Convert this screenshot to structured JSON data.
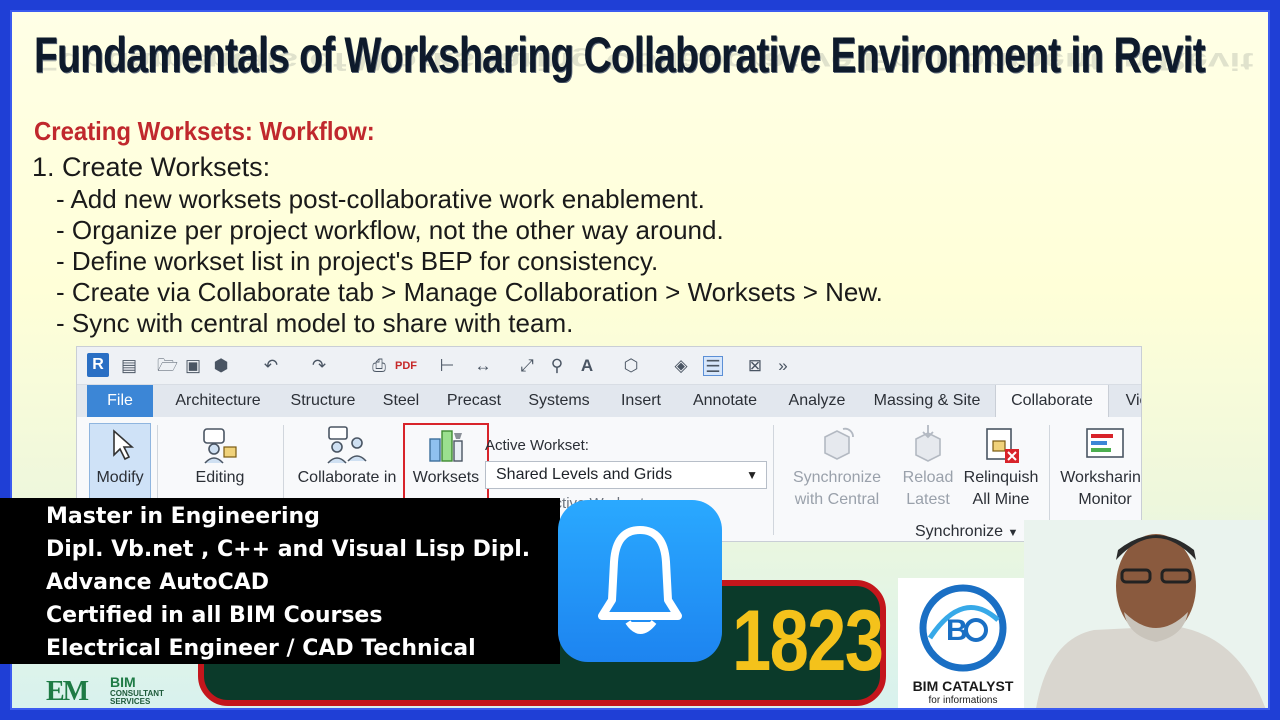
{
  "slide": {
    "title": "Fundamentals of Worksharing Collaborative Environment in Revit",
    "subtitle": "Creating Worksets: Workflow:",
    "step": "1. Create Worksets:",
    "bullets": [
      "- Add new worksets post-collaborative work enablement.",
      "- Organize per project workflow, not the other way around.",
      "- Define workset list in project's BEP for consistency.",
      "- Create via Collaborate tab > Manage Collaboration > Worksets > New.",
      "- Sync with central model to share with team."
    ]
  },
  "ribbon": {
    "app_logo": "R",
    "tabs": [
      "File",
      "Architecture",
      "Structure",
      "Steel",
      "Precast",
      "Systems",
      "Insert",
      "Annotate",
      "Analyze",
      "Massing & Site",
      "Collaborate",
      "Vie"
    ],
    "active_tab": "Collaborate",
    "tools": {
      "modify": "Modify",
      "editing": "Editing",
      "collaborate_in": "Collaborate in",
      "worksets": "Worksets",
      "synchronize_1": "Synchronize",
      "synchronize_2": "with Central",
      "reload_1": "Reload",
      "reload_2": "Latest",
      "relinquish_1": "Relinquish",
      "relinquish_2": "All Mine",
      "monitor_1": "Worksharing",
      "monitor_2": "Monitor"
    },
    "active_workset_label": "Active Workset:",
    "active_workset_value": "Shared Levels and Grids",
    "gray_inactive": "Gray Inactive Worksets",
    "synchronize_panel": "Synchronize"
  },
  "credentials": [
    "Master in Engineering",
    "Dipl. Vb.net , C++ and Visual Lisp Dipl.",
    "Advance AutoCAD",
    "Certified in all BIM Courses",
    "Electrical Engineer / CAD Technical"
  ],
  "phone_partial": "1823",
  "logos": {
    "bim_consultant_mark": "EM",
    "bim_consultant_1": "BIM",
    "bim_consultant_2": "CONSULTANT SERVICES",
    "catalyst_name": "BIM CATALYST",
    "catalyst_sub": "for informations"
  },
  "colors": {
    "border_blue": "#1f3fd6",
    "subtitle_red": "#c0282d",
    "file_tab_blue": "#3c86d6",
    "highlight_red": "#d8232a",
    "bell_blue": "#1d84f0",
    "phone_yellow": "#f4c21b"
  }
}
